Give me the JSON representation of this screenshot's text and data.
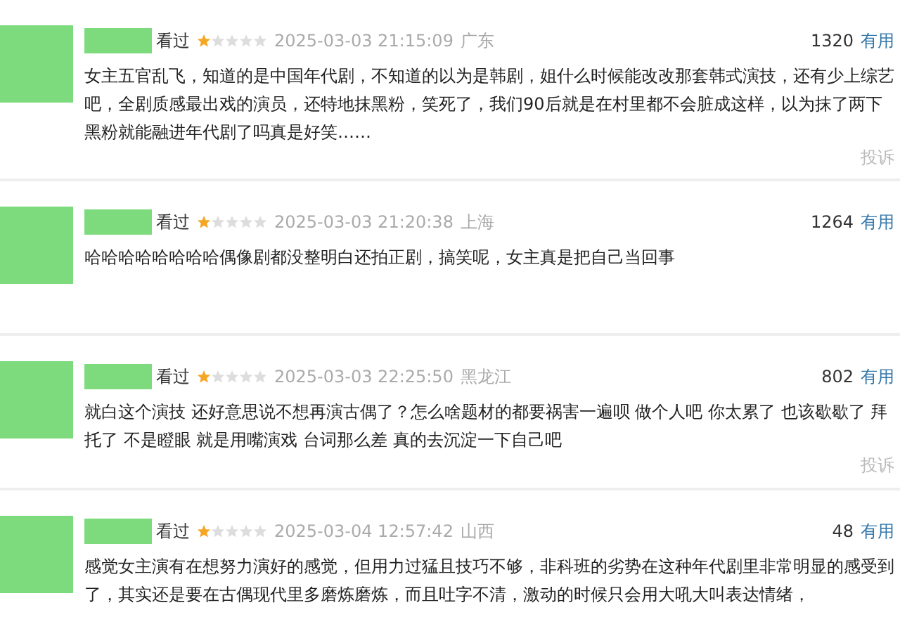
{
  "comments": [
    {
      "status": "看过",
      "stars": 1,
      "time": "2025-03-03 21:15:09",
      "location": "广东",
      "votes": "1320",
      "useful": "有用",
      "text": "女主五官乱飞，知道的是中国年代剧，不知道的以为是韩剧，姐什么时候能改改那套韩式演技，还有少上综艺吧，全剧质感最出戏的演员，还特地抹黑粉，笑死了，我们90后就是在村里都不会脏成这样，以为抹了两下黑粉就能融进年代剧了吗真是好笑……",
      "report": "投诉"
    },
    {
      "status": "看过",
      "stars": 1,
      "time": "2025-03-03 21:20:38",
      "location": "上海",
      "votes": "1264",
      "useful": "有用",
      "text": "哈哈哈哈哈哈哈哈偶像剧都没整明白还拍正剧，搞笑呢，女主真是把自己当回事"
    },
    {
      "status": "看过",
      "stars": 1,
      "time": "2025-03-03 22:25:50",
      "location": "黑龙江",
      "votes": "802",
      "useful": "有用",
      "text": "就白这个演技 还好意思说不想再演古偶了？怎么啥题材的都要祸害一遍呗 做个人吧 你太累了 也该歇歇了 拜托了 不是瞪眼 就是用嘴演戏 台词那么差 真的去沉淀一下自己吧",
      "report": "投诉"
    },
    {
      "status": "看过",
      "stars": 1,
      "time": "2025-03-04 12:57:42",
      "location": "山西",
      "votes": "48",
      "useful": "有用",
      "text": "感觉女主演有在想努力演好的感觉，但用力过猛且技巧不够，非科班的劣势在这种年代剧里非常明显的感受到了，其实还是要在古偶现代里多磨炼磨炼，而且吐字不清，激动的时候只会用大吼大叫表达情绪，"
    }
  ]
}
